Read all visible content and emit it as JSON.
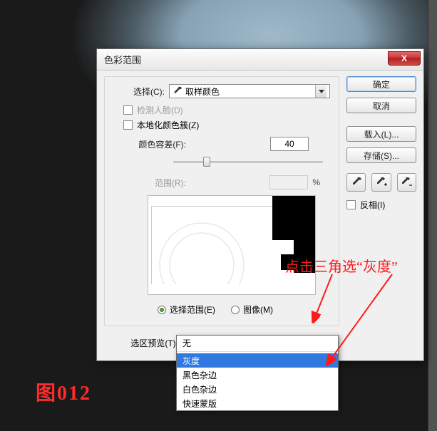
{
  "dialog": {
    "title": "色彩范围",
    "close_icon": "X",
    "select_label": "选择(C):",
    "select_value": "取样颜色",
    "detect_faces": "检测人脸(D)",
    "localized": "本地化颜色簇(Z)",
    "fuzziness_label": "颜色容差(F):",
    "fuzziness_value": "40",
    "range_label": "范围(R):",
    "range_value": "",
    "range_pct": "%",
    "radio_selection": "选择范围(E)",
    "radio_image": "图像(M)",
    "preview_label": "选区预览(T):",
    "preview_value": "无"
  },
  "buttons": {
    "ok": "确定",
    "cancel": "取消",
    "load": "载入(L)...",
    "save": "存储(S)..."
  },
  "invert": {
    "label": "反相(I)"
  },
  "dropdown_options": {
    "none": "无",
    "gray": "灰度",
    "black_matte": "黑色杂边",
    "white_matte": "白色杂边",
    "quick_mask": "快速蒙版"
  },
  "annotation": {
    "text": "点击三角选“灰度”"
  },
  "figure_label": "图012",
  "eyedroppers": {
    "sample": "eyedropper",
    "add": "eyedropper-plus",
    "sub": "eyedropper-minus"
  }
}
